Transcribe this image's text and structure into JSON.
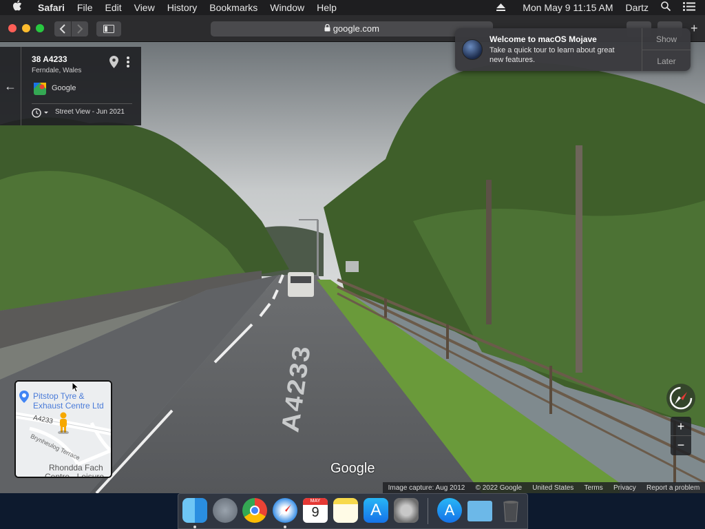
{
  "menubar": {
    "apple_icon": "apple-icon",
    "app_name": "Safari",
    "menus": [
      "File",
      "Edit",
      "View",
      "History",
      "Bookmarks",
      "Window",
      "Help"
    ],
    "datetime": "Mon May 9  11:15 AM",
    "user": "Dartz"
  },
  "toolbar": {
    "url": "google.com"
  },
  "location_card": {
    "address": "38 A4233",
    "locality": "Ferndale, Wales",
    "provider": "Google",
    "street_view_date": "Street View - Jun 2021"
  },
  "notification": {
    "title": "Welcome to macOS Mojave",
    "body_line1": "Take a quick tour to learn about great",
    "body_line2": "new features.",
    "show_label": "Show",
    "later_label": "Later"
  },
  "street_view": {
    "road_marking": "A4233",
    "watermark": "Google"
  },
  "minimap": {
    "place_line1": "Pitstop Tyre &",
    "place_line2": "Exhaust Centre Ltd",
    "road": "A4233",
    "street": "Brynheulog Terrace",
    "place2_line1": "Rhondda Fach",
    "place2_line2": "Centre - Leisure"
  },
  "controls": {
    "zoom_in": "+",
    "zoom_out": "−"
  },
  "footer": {
    "capture": "Image capture: Aug 2012",
    "copyright": "© 2022 Google",
    "region": "United States",
    "terms": "Terms",
    "privacy": "Privacy",
    "report": "Report a problem"
  },
  "dock": {
    "apps": [
      "finder-icon",
      "launchpad-icon",
      "chrome-icon",
      "safari-icon",
      "calendar-icon",
      "notes-icon",
      "app-store-icon",
      "system-preferences-icon",
      "app-store-downloads-icon",
      "folder-icon",
      "trash-icon"
    ],
    "calendar_month": "MAY",
    "calendar_day": "9"
  }
}
